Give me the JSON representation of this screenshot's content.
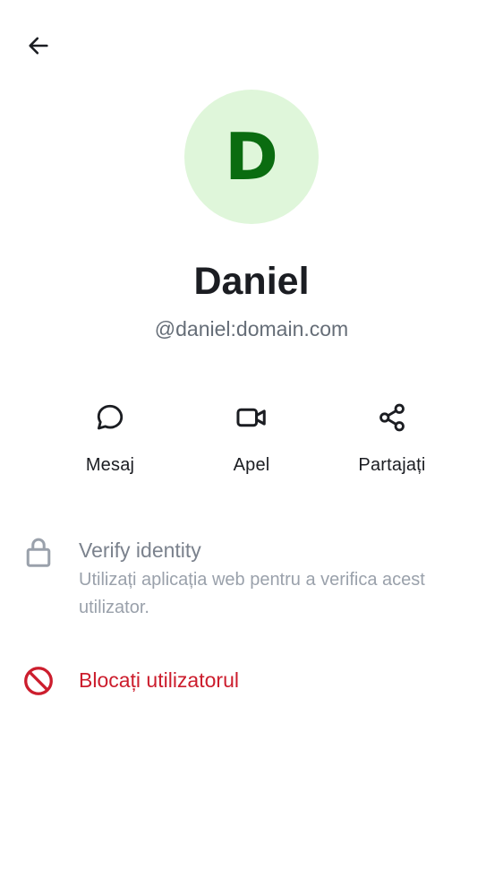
{
  "header": {
    "back_icon": "arrow-left-icon"
  },
  "profile": {
    "avatar_initial": "D",
    "display_name": "Daniel",
    "user_id": "@daniel:domain.com",
    "avatar_bg_color": "#dff6da",
    "avatar_text_color": "#0a6c10"
  },
  "actions": [
    {
      "label": "Mesaj",
      "icon": "chat-bubble-icon"
    },
    {
      "label": "Apel",
      "icon": "video-camera-icon"
    },
    {
      "label": "Partajați",
      "icon": "share-icon"
    }
  ],
  "verify": {
    "title": "Verify identity",
    "description": "Utilizați aplicația web pentru a verifica acest utilizator.",
    "icon": "lock-icon"
  },
  "block": {
    "label": "Blocați utilizatorul",
    "icon": "block-icon",
    "color": "#cc1d2d"
  }
}
